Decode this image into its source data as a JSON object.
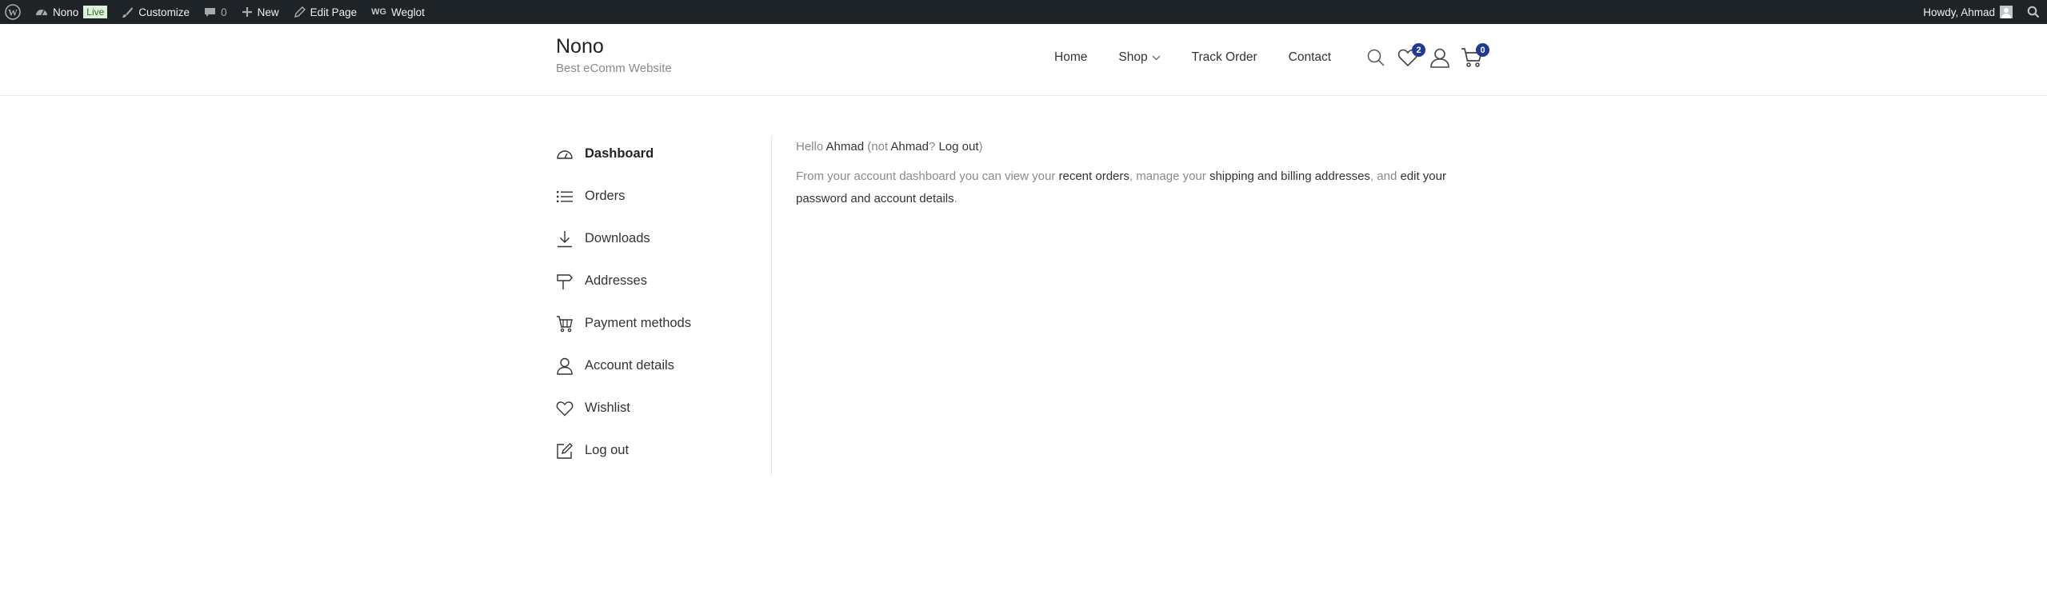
{
  "adminbar": {
    "site_name": "Nono",
    "live_badge": "Live",
    "customize": "Customize",
    "comments_count": "0",
    "new": "New",
    "edit_page": "Edit Page",
    "weglot_prefix": "WG",
    "weglot": "Weglot",
    "howdy": "Howdy, Ahmad"
  },
  "header": {
    "site_title": "Nono",
    "tagline": "Best eComm Website",
    "nav": {
      "home": "Home",
      "shop": "Shop",
      "track_order": "Track Order",
      "contact": "Contact"
    },
    "wishlist_count": "2",
    "cart_count": "0",
    "accent_color": "#1f3a93"
  },
  "account_nav": {
    "dashboard": "Dashboard",
    "orders": "Orders",
    "downloads": "Downloads",
    "addresses": "Addresses",
    "payment_methods": "Payment methods",
    "account_details": "Account details",
    "wishlist": "Wishlist",
    "logout": "Log out"
  },
  "content": {
    "hello": "Hello",
    "user_name": "Ahmad",
    "not_prefix": " (not ",
    "user_name_2": "Ahmad",
    "q_mark": "? ",
    "logout_link": "Log out",
    "close_paren": ")",
    "desc_1": "From your account dashboard you can view your ",
    "recent_orders": "recent orders",
    "desc_2": ", manage your ",
    "addresses_link": "shipping and billing addresses",
    "desc_3": ", and ",
    "edit_link": "edit your password and account details",
    "desc_end": "."
  }
}
